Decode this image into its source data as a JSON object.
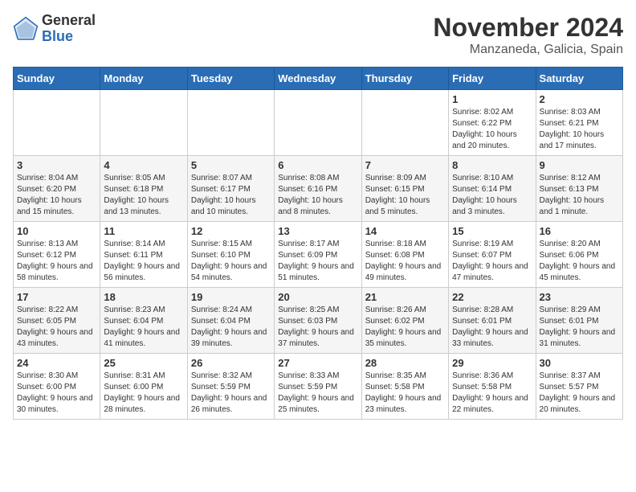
{
  "header": {
    "logo_general": "General",
    "logo_blue": "Blue",
    "month_title": "November 2024",
    "location": "Manzaneda, Galicia, Spain"
  },
  "weekdays": [
    "Sunday",
    "Monday",
    "Tuesday",
    "Wednesday",
    "Thursday",
    "Friday",
    "Saturday"
  ],
  "weeks": [
    [
      {
        "day": "",
        "info": ""
      },
      {
        "day": "",
        "info": ""
      },
      {
        "day": "",
        "info": ""
      },
      {
        "day": "",
        "info": ""
      },
      {
        "day": "",
        "info": ""
      },
      {
        "day": "1",
        "info": "Sunrise: 8:02 AM\nSunset: 6:22 PM\nDaylight: 10 hours and 20 minutes."
      },
      {
        "day": "2",
        "info": "Sunrise: 8:03 AM\nSunset: 6:21 PM\nDaylight: 10 hours and 17 minutes."
      }
    ],
    [
      {
        "day": "3",
        "info": "Sunrise: 8:04 AM\nSunset: 6:20 PM\nDaylight: 10 hours and 15 minutes."
      },
      {
        "day": "4",
        "info": "Sunrise: 8:05 AM\nSunset: 6:18 PM\nDaylight: 10 hours and 13 minutes."
      },
      {
        "day": "5",
        "info": "Sunrise: 8:07 AM\nSunset: 6:17 PM\nDaylight: 10 hours and 10 minutes."
      },
      {
        "day": "6",
        "info": "Sunrise: 8:08 AM\nSunset: 6:16 PM\nDaylight: 10 hours and 8 minutes."
      },
      {
        "day": "7",
        "info": "Sunrise: 8:09 AM\nSunset: 6:15 PM\nDaylight: 10 hours and 5 minutes."
      },
      {
        "day": "8",
        "info": "Sunrise: 8:10 AM\nSunset: 6:14 PM\nDaylight: 10 hours and 3 minutes."
      },
      {
        "day": "9",
        "info": "Sunrise: 8:12 AM\nSunset: 6:13 PM\nDaylight: 10 hours and 1 minute."
      }
    ],
    [
      {
        "day": "10",
        "info": "Sunrise: 8:13 AM\nSunset: 6:12 PM\nDaylight: 9 hours and 58 minutes."
      },
      {
        "day": "11",
        "info": "Sunrise: 8:14 AM\nSunset: 6:11 PM\nDaylight: 9 hours and 56 minutes."
      },
      {
        "day": "12",
        "info": "Sunrise: 8:15 AM\nSunset: 6:10 PM\nDaylight: 9 hours and 54 minutes."
      },
      {
        "day": "13",
        "info": "Sunrise: 8:17 AM\nSunset: 6:09 PM\nDaylight: 9 hours and 51 minutes."
      },
      {
        "day": "14",
        "info": "Sunrise: 8:18 AM\nSunset: 6:08 PM\nDaylight: 9 hours and 49 minutes."
      },
      {
        "day": "15",
        "info": "Sunrise: 8:19 AM\nSunset: 6:07 PM\nDaylight: 9 hours and 47 minutes."
      },
      {
        "day": "16",
        "info": "Sunrise: 8:20 AM\nSunset: 6:06 PM\nDaylight: 9 hours and 45 minutes."
      }
    ],
    [
      {
        "day": "17",
        "info": "Sunrise: 8:22 AM\nSunset: 6:05 PM\nDaylight: 9 hours and 43 minutes."
      },
      {
        "day": "18",
        "info": "Sunrise: 8:23 AM\nSunset: 6:04 PM\nDaylight: 9 hours and 41 minutes."
      },
      {
        "day": "19",
        "info": "Sunrise: 8:24 AM\nSunset: 6:04 PM\nDaylight: 9 hours and 39 minutes."
      },
      {
        "day": "20",
        "info": "Sunrise: 8:25 AM\nSunset: 6:03 PM\nDaylight: 9 hours and 37 minutes."
      },
      {
        "day": "21",
        "info": "Sunrise: 8:26 AM\nSunset: 6:02 PM\nDaylight: 9 hours and 35 minutes."
      },
      {
        "day": "22",
        "info": "Sunrise: 8:28 AM\nSunset: 6:01 PM\nDaylight: 9 hours and 33 minutes."
      },
      {
        "day": "23",
        "info": "Sunrise: 8:29 AM\nSunset: 6:01 PM\nDaylight: 9 hours and 31 minutes."
      }
    ],
    [
      {
        "day": "24",
        "info": "Sunrise: 8:30 AM\nSunset: 6:00 PM\nDaylight: 9 hours and 30 minutes."
      },
      {
        "day": "25",
        "info": "Sunrise: 8:31 AM\nSunset: 6:00 PM\nDaylight: 9 hours and 28 minutes."
      },
      {
        "day": "26",
        "info": "Sunrise: 8:32 AM\nSunset: 5:59 PM\nDaylight: 9 hours and 26 minutes."
      },
      {
        "day": "27",
        "info": "Sunrise: 8:33 AM\nSunset: 5:59 PM\nDaylight: 9 hours and 25 minutes."
      },
      {
        "day": "28",
        "info": "Sunrise: 8:35 AM\nSunset: 5:58 PM\nDaylight: 9 hours and 23 minutes."
      },
      {
        "day": "29",
        "info": "Sunrise: 8:36 AM\nSunset: 5:58 PM\nDaylight: 9 hours and 22 minutes."
      },
      {
        "day": "30",
        "info": "Sunrise: 8:37 AM\nSunset: 5:57 PM\nDaylight: 9 hours and 20 minutes."
      }
    ]
  ]
}
